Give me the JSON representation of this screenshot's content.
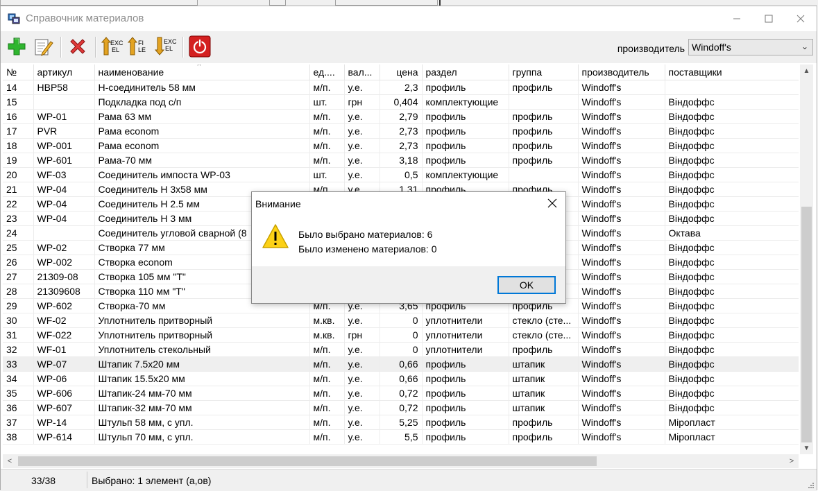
{
  "window": {
    "title": "Справочник материалов"
  },
  "toolbar": {
    "buttons": [
      {
        "name": "add"
      },
      {
        "name": "edit"
      },
      {
        "name": "delete"
      },
      {
        "name": "import-excel",
        "label": "EXC EL"
      },
      {
        "name": "import-file",
        "label": "FI LE"
      },
      {
        "name": "export-excel",
        "label": "EXC EL"
      },
      {
        "name": "exit"
      }
    ],
    "manufacturer_label": "производитель",
    "manufacturer_value": "Windoff's"
  },
  "table": {
    "columns": [
      "№",
      "артикул",
      "наименование",
      "ед....",
      "вал...",
      "цена",
      "раздел",
      "группа",
      "производитель",
      "поставщики"
    ],
    "rows": [
      [
        "14",
        "HBP58",
        "Н-соединитель 58 мм",
        "м/п.",
        "у.е.",
        "2,3",
        "профиль",
        "профиль",
        "Windoff's",
        ""
      ],
      [
        "15",
        "",
        "Подкладка под с/п",
        "шт.",
        "грн",
        "0,404",
        "комплектующие",
        "",
        "Windoff's",
        "Віндоффс"
      ],
      [
        "16",
        "WP-01",
        "Рама   63 мм",
        "м/п.",
        "у.е.",
        "2,79",
        "профиль",
        "профиль",
        "Windoff's",
        "Віндоффс"
      ],
      [
        "17",
        "PVR",
        "Рама  econom",
        "м/п.",
        "у.е.",
        "2,73",
        "профиль",
        "профиль",
        "Windoff's",
        "Віндоффс"
      ],
      [
        "18",
        "WP-001",
        "Рама  econom",
        "м/п.",
        "у.е.",
        "2,73",
        "профиль",
        "профиль",
        "Windoff's",
        "Віндоффс"
      ],
      [
        "19",
        "WP-601",
        "Рама-70 мм",
        "м/п.",
        "у.е.",
        "3,18",
        "профиль",
        "профиль",
        "Windoff's",
        "Віндоффс"
      ],
      [
        "20",
        "WF-03",
        "Соединитель импоста WP-03",
        "шт.",
        "у.е.",
        "0,5",
        "комплектующие",
        "",
        "Windoff's",
        "Віндоффс"
      ],
      [
        "21",
        "WP-04",
        "Соединитель Н   3х58 мм",
        "м/п.",
        "у.е.",
        "1,31",
        "профиль",
        "профиль",
        "Windoff's",
        "Віндоффс"
      ],
      [
        "22",
        "WP-04",
        "Соединитель Н  2.5 мм",
        "",
        "",
        "",
        "",
        "",
        "Windoff's",
        "Віндоффс"
      ],
      [
        "23",
        "WP-04",
        "Соединитель Н  3 мм",
        "",
        "",
        "",
        "",
        "",
        "Windoff's",
        "Віндоффс"
      ],
      [
        "24",
        "",
        "Соединитель угловой сварной (8",
        "",
        "",
        "",
        "",
        "",
        "Windoff's",
        "Октава"
      ],
      [
        "25",
        "WP-02",
        "Створка   77 мм",
        "",
        "",
        "",
        "",
        "",
        "Windoff's",
        "Віндоффс"
      ],
      [
        "26",
        "WP-002",
        "Створка   econom",
        "",
        "",
        "",
        "",
        "",
        "Windoff's",
        "Віндоффс"
      ],
      [
        "27",
        "21309-08",
        "Створка 105 мм \"Т\"",
        "",
        "",
        "",
        "",
        "",
        "Windoff's",
        "Віндоффс"
      ],
      [
        "28",
        "21309608",
        "Створка 110 мм \"Т\"",
        "",
        "",
        "",
        "",
        "",
        "Windoff's",
        "Віндоффс"
      ],
      [
        "29",
        "WP-602",
        "Створка-70 мм",
        "м/п.",
        "у.е.",
        "3,65",
        "профиль",
        "профиль",
        "Windoff's",
        "Віндоффс"
      ],
      [
        "30",
        "WF-02",
        "Уплотнитель притворный",
        "м.кв.",
        "у.е.",
        "0",
        "уплотнители",
        "стекло (сте...",
        "Windoff's",
        "Віндоффс"
      ],
      [
        "31",
        "WF-022",
        "Уплотнитель притворный",
        "м.кв.",
        "грн",
        "0",
        "уплотнители",
        "стекло (сте...",
        "Windoff's",
        "Віндоффс"
      ],
      [
        "32",
        "WF-01",
        "Уплотнитель стекольный",
        "м/п.",
        "у.е.",
        "0",
        "уплотнители",
        "профиль",
        "Windoff's",
        "Віндоффс"
      ],
      [
        "33",
        "WP-07",
        "Штапик   7.5х20 мм",
        "м/п.",
        "у.е.",
        "0,66",
        "профиль",
        "штапик",
        "Windoff's",
        "Віндоффс"
      ],
      [
        "34",
        "WP-06",
        "Штапик 15.5х20 мм",
        "м/п.",
        "у.е.",
        "0,66",
        "профиль",
        "штапик",
        "Windoff's",
        "Віндоффс"
      ],
      [
        "35",
        "WP-606",
        "Штапик-24 мм-70 мм",
        "м/п.",
        "у.е.",
        "0,72",
        "профиль",
        "штапик",
        "Windoff's",
        "Віндоффс"
      ],
      [
        "36",
        "WP-607",
        "Штапик-32 мм-70 мм",
        "м/п.",
        "у.е.",
        "0,72",
        "профиль",
        "штапик",
        "Windoff's",
        "Віндоффс"
      ],
      [
        "37",
        "WP-14",
        "Штульп  58 мм, с упл.",
        "м/п.",
        "у.е.",
        "5,25",
        "профиль",
        "профиль",
        "Windoff's",
        "Міропласт"
      ],
      [
        "38",
        "WP-614",
        "Штульп  70 мм, с упл.",
        "м/п.",
        "у.е.",
        "5,5",
        "профиль",
        "профиль",
        "Windoff's",
        "Міропласт"
      ]
    ],
    "selected_row": "33"
  },
  "status": {
    "position": "33/38",
    "message": "Выбрано: 1 элемент (а,ов)"
  },
  "dialog": {
    "title": "Внимание",
    "line1": "Было выбрано материалов: 6",
    "line2": "Было изменено материалов: 0",
    "ok_label": "OK"
  },
  "icons": {
    "warning": "warning-triangle-icon",
    "accent": "#0078d7"
  }
}
